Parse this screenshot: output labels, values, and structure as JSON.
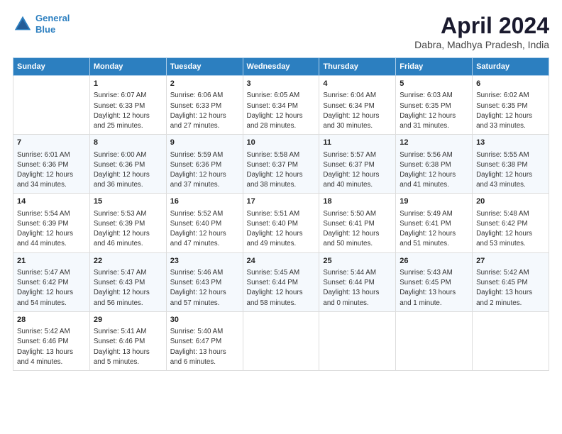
{
  "logo": {
    "line1": "General",
    "line2": "Blue"
  },
  "title": "April 2024",
  "subtitle": "Dabra, Madhya Pradesh, India",
  "weekdays": [
    "Sunday",
    "Monday",
    "Tuesday",
    "Wednesday",
    "Thursday",
    "Friday",
    "Saturday"
  ],
  "rows": [
    [
      {
        "num": "",
        "text": ""
      },
      {
        "num": "1",
        "text": "Sunrise: 6:07 AM\nSunset: 6:33 PM\nDaylight: 12 hours\nand 25 minutes."
      },
      {
        "num": "2",
        "text": "Sunrise: 6:06 AM\nSunset: 6:33 PM\nDaylight: 12 hours\nand 27 minutes."
      },
      {
        "num": "3",
        "text": "Sunrise: 6:05 AM\nSunset: 6:34 PM\nDaylight: 12 hours\nand 28 minutes."
      },
      {
        "num": "4",
        "text": "Sunrise: 6:04 AM\nSunset: 6:34 PM\nDaylight: 12 hours\nand 30 minutes."
      },
      {
        "num": "5",
        "text": "Sunrise: 6:03 AM\nSunset: 6:35 PM\nDaylight: 12 hours\nand 31 minutes."
      },
      {
        "num": "6",
        "text": "Sunrise: 6:02 AM\nSunset: 6:35 PM\nDaylight: 12 hours\nand 33 minutes."
      }
    ],
    [
      {
        "num": "7",
        "text": "Sunrise: 6:01 AM\nSunset: 6:36 PM\nDaylight: 12 hours\nand 34 minutes."
      },
      {
        "num": "8",
        "text": "Sunrise: 6:00 AM\nSunset: 6:36 PM\nDaylight: 12 hours\nand 36 minutes."
      },
      {
        "num": "9",
        "text": "Sunrise: 5:59 AM\nSunset: 6:36 PM\nDaylight: 12 hours\nand 37 minutes."
      },
      {
        "num": "10",
        "text": "Sunrise: 5:58 AM\nSunset: 6:37 PM\nDaylight: 12 hours\nand 38 minutes."
      },
      {
        "num": "11",
        "text": "Sunrise: 5:57 AM\nSunset: 6:37 PM\nDaylight: 12 hours\nand 40 minutes."
      },
      {
        "num": "12",
        "text": "Sunrise: 5:56 AM\nSunset: 6:38 PM\nDaylight: 12 hours\nand 41 minutes."
      },
      {
        "num": "13",
        "text": "Sunrise: 5:55 AM\nSunset: 6:38 PM\nDaylight: 12 hours\nand 43 minutes."
      }
    ],
    [
      {
        "num": "14",
        "text": "Sunrise: 5:54 AM\nSunset: 6:39 PM\nDaylight: 12 hours\nand 44 minutes."
      },
      {
        "num": "15",
        "text": "Sunrise: 5:53 AM\nSunset: 6:39 PM\nDaylight: 12 hours\nand 46 minutes."
      },
      {
        "num": "16",
        "text": "Sunrise: 5:52 AM\nSunset: 6:40 PM\nDaylight: 12 hours\nand 47 minutes."
      },
      {
        "num": "17",
        "text": "Sunrise: 5:51 AM\nSunset: 6:40 PM\nDaylight: 12 hours\nand 49 minutes."
      },
      {
        "num": "18",
        "text": "Sunrise: 5:50 AM\nSunset: 6:41 PM\nDaylight: 12 hours\nand 50 minutes."
      },
      {
        "num": "19",
        "text": "Sunrise: 5:49 AM\nSunset: 6:41 PM\nDaylight: 12 hours\nand 51 minutes."
      },
      {
        "num": "20",
        "text": "Sunrise: 5:48 AM\nSunset: 6:42 PM\nDaylight: 12 hours\nand 53 minutes."
      }
    ],
    [
      {
        "num": "21",
        "text": "Sunrise: 5:47 AM\nSunset: 6:42 PM\nDaylight: 12 hours\nand 54 minutes."
      },
      {
        "num": "22",
        "text": "Sunrise: 5:47 AM\nSunset: 6:43 PM\nDaylight: 12 hours\nand 56 minutes."
      },
      {
        "num": "23",
        "text": "Sunrise: 5:46 AM\nSunset: 6:43 PM\nDaylight: 12 hours\nand 57 minutes."
      },
      {
        "num": "24",
        "text": "Sunrise: 5:45 AM\nSunset: 6:44 PM\nDaylight: 12 hours\nand 58 minutes."
      },
      {
        "num": "25",
        "text": "Sunrise: 5:44 AM\nSunset: 6:44 PM\nDaylight: 13 hours\nand 0 minutes."
      },
      {
        "num": "26",
        "text": "Sunrise: 5:43 AM\nSunset: 6:45 PM\nDaylight: 13 hours\nand 1 minute."
      },
      {
        "num": "27",
        "text": "Sunrise: 5:42 AM\nSunset: 6:45 PM\nDaylight: 13 hours\nand 2 minutes."
      }
    ],
    [
      {
        "num": "28",
        "text": "Sunrise: 5:42 AM\nSunset: 6:46 PM\nDaylight: 13 hours\nand 4 minutes."
      },
      {
        "num": "29",
        "text": "Sunrise: 5:41 AM\nSunset: 6:46 PM\nDaylight: 13 hours\nand 5 minutes."
      },
      {
        "num": "30",
        "text": "Sunrise: 5:40 AM\nSunset: 6:47 PM\nDaylight: 13 hours\nand 6 minutes."
      },
      {
        "num": "",
        "text": ""
      },
      {
        "num": "",
        "text": ""
      },
      {
        "num": "",
        "text": ""
      },
      {
        "num": "",
        "text": ""
      }
    ]
  ]
}
